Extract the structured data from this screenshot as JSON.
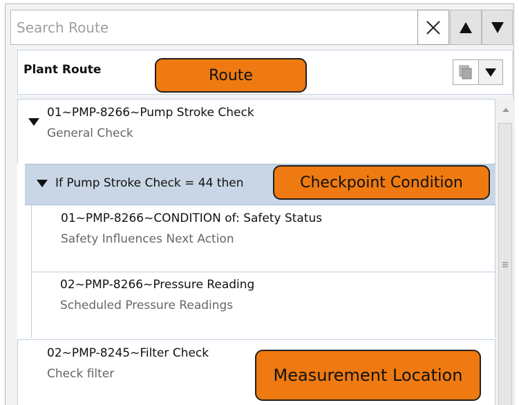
{
  "search": {
    "placeholder": "Search Route"
  },
  "route": {
    "title": "Plant Route"
  },
  "items": [
    {
      "name": "01~PMP-8266~Pump Stroke Check",
      "desc": "General Check"
    },
    {
      "name": "01~PMP-8266~CONDITION of: Safety Status",
      "desc": "Safety Influences Next Action"
    },
    {
      "name": "02~PMP-8266~Pressure Reading",
      "desc": "Scheduled Pressure Readings"
    },
    {
      "name": "02~PMP-8245~Filter Check",
      "desc": "Check filter"
    }
  ],
  "condition": {
    "text": "If Pump Stroke Check = 44 then"
  },
  "callouts": {
    "route": "Route",
    "checkpoint": "Checkpoint Condition",
    "measurement": "Measurement Location"
  },
  "icons": {
    "clear": "close-icon",
    "up": "arrow-up-icon",
    "down": "arrow-down-icon",
    "copy": "copy-icon",
    "dropdown": "chevron-down-icon",
    "expand": "triangle-down-icon",
    "scroll_grip": "scroll-grip-icon"
  },
  "colors": {
    "callout": "#ee7a11",
    "condition_bg": "#c9d6e5"
  }
}
